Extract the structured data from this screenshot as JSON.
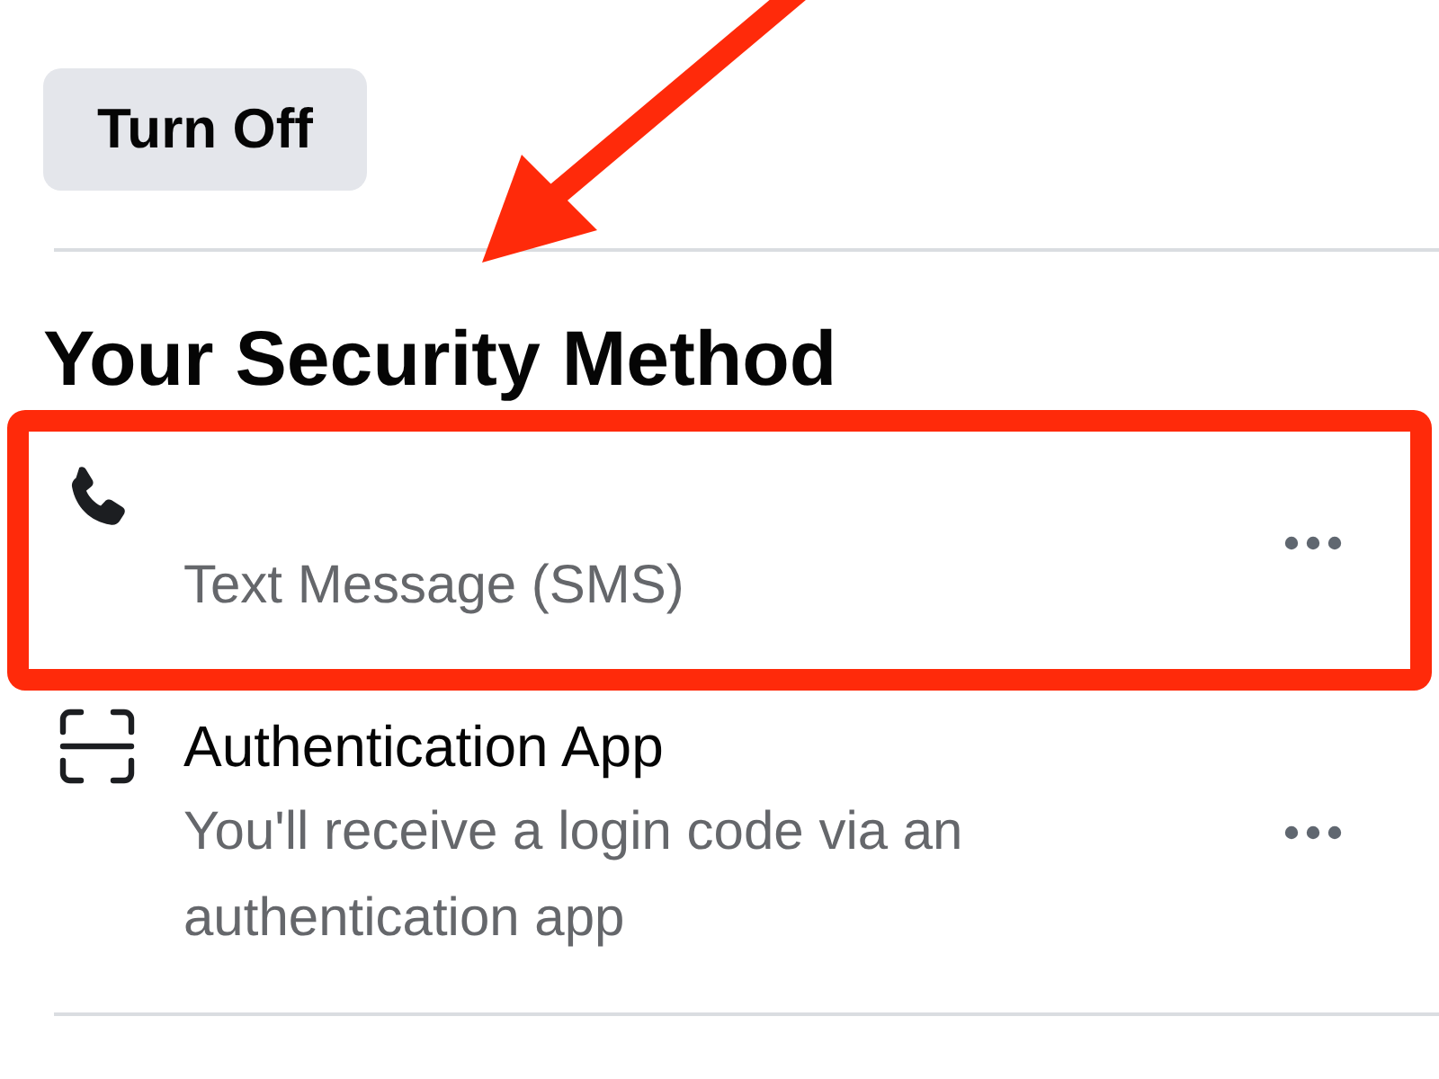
{
  "turn_off_button": {
    "label": "Turn Off"
  },
  "section": {
    "heading": "Your Security Method",
    "methods": [
      {
        "kind": "phone",
        "description": "Text Message (SMS)",
        "highlighted": true
      },
      {
        "kind": "app",
        "title": "Authentication App",
        "description": "You'll receive a login code via an authentication app",
        "highlighted": false
      }
    ]
  }
}
